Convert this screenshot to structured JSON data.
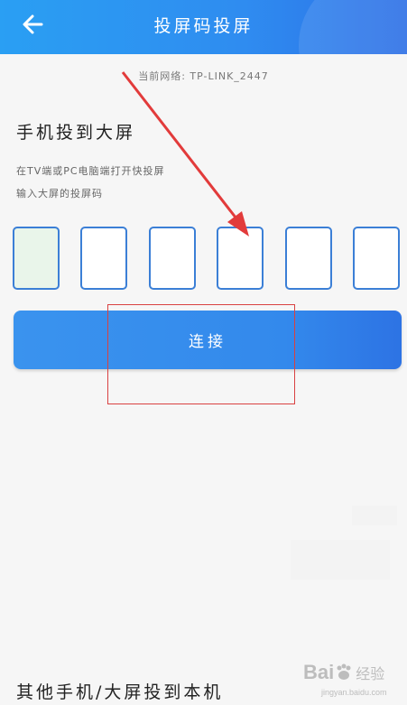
{
  "header": {
    "title": "投屏码投屏",
    "back_icon": "arrow-left-icon",
    "background": "#2f8cf0"
  },
  "network_label": "当前网络: TP-LINK_2447",
  "cast_section": {
    "title": "手机投到大屏",
    "desc_line1": "在TV端或PC电脑端打开快投屏",
    "desc_line2": "输入大屏的投屏码",
    "code_digits": [
      "",
      "",
      "",
      "",
      "",
      ""
    ],
    "connect_label": "连接",
    "accent": "#3389ec",
    "box_border": "#3b7fd6"
  },
  "other_section": {
    "title": "其他手机/大屏投到本机"
  },
  "annotation": {
    "color": "#d94141"
  },
  "watermark": {
    "text": "Bai",
    "cn": "经验",
    "url": "jingyan.baidu.com"
  }
}
